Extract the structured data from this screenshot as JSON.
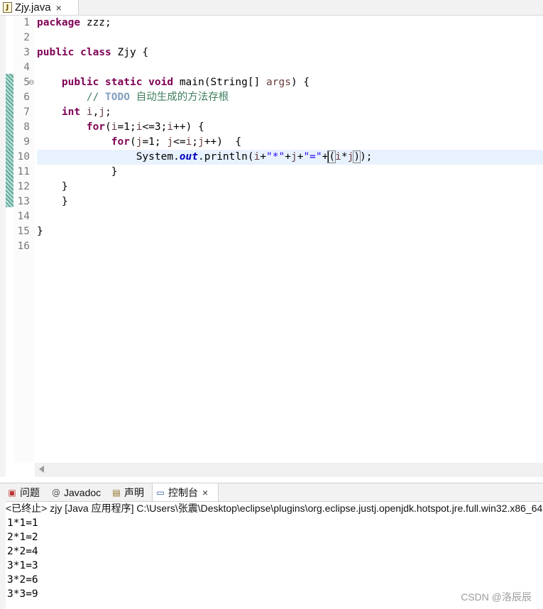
{
  "editor": {
    "tab_label": "Zjy.java",
    "tab_close": "×",
    "lines": [
      {
        "n": "1"
      },
      {
        "n": "2"
      },
      {
        "n": "3"
      },
      {
        "n": "4"
      },
      {
        "n": "5"
      },
      {
        "n": "6"
      },
      {
        "n": "7"
      },
      {
        "n": "8"
      },
      {
        "n": "9"
      },
      {
        "n": "10"
      },
      {
        "n": "11"
      },
      {
        "n": "12"
      },
      {
        "n": "13"
      },
      {
        "n": "14"
      },
      {
        "n": "15"
      },
      {
        "n": "16"
      }
    ],
    "code": {
      "l1_kw": "package",
      "l1_rest": " zzz;",
      "l3_kw1": "public",
      "l3_kw2": "class",
      "l3_rest": " Zjy {",
      "l5_kw1": "public",
      "l5_kw2": "static",
      "l5_kw3": "void",
      "l5_mid": " main(String[] ",
      "l5_var": "args",
      "l5_end": ") {",
      "l6_cm1": "// ",
      "l6_todo": "TODO",
      "l6_cm2": " 自动生成的方法存根",
      "l7_kw": "int",
      "l7_v1": " i",
      "l7_mid": ",",
      "l7_v2": "j",
      "l7_end": ";",
      "l8_kw": "for",
      "l8_p1": "(",
      "l8_v1": "i",
      "l8_p2": "=1;",
      "l8_v2": "i",
      "l8_p3": "<=3;",
      "l8_v3": "i",
      "l8_p4": "++) {",
      "l9_kw": "for",
      "l9_p1": "(",
      "l9_v1": "j",
      "l9_p2": "=1; ",
      "l9_v2": "j",
      "l9_p3": "<=",
      "l9_v3": "i",
      "l9_p4": ";",
      "l9_v4": "j",
      "l9_p5": "++)  {",
      "l10_a": "System.",
      "l10_fld": "out",
      "l10_b": ".println(",
      "l10_v1": "i",
      "l10_c": "+",
      "l10_s1": "\"*\"",
      "l10_d": "+",
      "l10_v2": "j",
      "l10_e": "+",
      "l10_s2": "\"=\"",
      "l10_f": "+",
      "l10_g": "(",
      "l10_v3": "i",
      "l10_h": "*",
      "l10_v4": "j",
      "l10_i": ")",
      "l10_j": ");",
      "l11": "}",
      "l12": "}",
      "l13": "}",
      "l15": "}"
    }
  },
  "panel": {
    "tabs": [
      {
        "label": "问题",
        "icon": "problems-icon"
      },
      {
        "label": "Javadoc",
        "icon": "javadoc-at-icon"
      },
      {
        "label": "声明",
        "icon": "declaration-icon"
      },
      {
        "label": "控制台",
        "icon": "console-icon"
      }
    ],
    "close": "×",
    "console_header": "<已终止> zjy [Java 应用程序] C:\\Users\\张震\\Desktop\\eclipse\\plugins\\org.eclipse.justj.openjdk.hotspot.jre.full.win32.x86_64",
    "output": [
      "1*1=1",
      "2*1=2",
      "2*2=4",
      "3*1=3",
      "3*2=6",
      "3*3=9"
    ]
  },
  "watermark": "CSDN @洛辰辰"
}
